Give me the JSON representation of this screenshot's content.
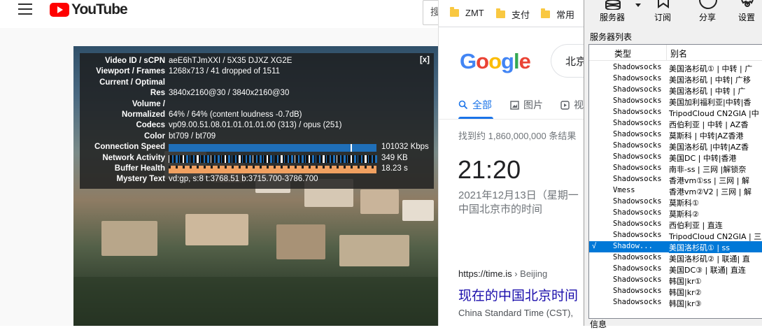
{
  "youtube": {
    "logo_text": "YouTube",
    "search_partial": "搜",
    "stats": {
      "close": "[x]",
      "rows": [
        {
          "key": "Video ID / sCPN",
          "value": "aeE6hTJmXXI / 5X35 DJXZ XG2E"
        },
        {
          "key": "Viewport / Frames",
          "value": "1268x713 / 41 dropped of 1511"
        },
        {
          "key": "Current / Optimal",
          "value": ""
        },
        {
          "key": "Res",
          "value": "3840x2160@30 / 3840x2160@30"
        },
        {
          "key": "Volume /",
          "value": ""
        },
        {
          "key": "Normalized",
          "value": "64% / 64% (content loudness -0.7dB)"
        },
        {
          "key": "Codecs",
          "value": "vp09.00.51.08.01.01.01.01.00 (313) / opus (251)"
        },
        {
          "key": "Color",
          "value": "bt709 / bt709"
        },
        {
          "key": "Connection Speed",
          "value": "101032 Kbps"
        },
        {
          "key": "Network Activity",
          "value": "349 KB"
        },
        {
          "key": "Buffer Health",
          "value": "18.23 s"
        },
        {
          "key": "Mystery Text",
          "value": "vd:gp, s:8 t:3768.51 b:3715.700-3786.700"
        }
      ],
      "colors": {
        "connection": "#1f6fb8",
        "network": "#1f6fb8",
        "buffer": "#f0a060"
      }
    }
  },
  "browser": {
    "bookmarks": [
      "ZMT",
      "支付",
      "常用"
    ],
    "google_logo": [
      "G",
      "o",
      "o",
      "g",
      "l",
      "e"
    ],
    "search_partial": "北京",
    "tabs": {
      "all": "全部",
      "images": "图片",
      "video": "视"
    },
    "result_count": "找到约 1,860,000,000 条结果",
    "time": "21:20",
    "date": "2021年12月13日（星期一",
    "location": "中国北京市的时间",
    "result": {
      "url": "https://time.is",
      "crumb": "› Beijing",
      "title": "现在的中国北京时间",
      "snippet": "China Standard Time (CST),"
    }
  },
  "server_window": {
    "toolbar": {
      "servers": "服务器",
      "subscribe": "订阅",
      "share": "分享",
      "settings": "设置"
    },
    "title": "服务器列表",
    "columns": {
      "type": "类型",
      "alias": "别名"
    },
    "rows": [
      {
        "check": "",
        "type": "Shadowsocks",
        "alias": "美国洛杉矶① | 中转 | 广"
      },
      {
        "check": "",
        "type": "Shadowsocks",
        "alias": "美国洛杉矶 | 中转| 广移"
      },
      {
        "check": "",
        "type": "Shadowsocks",
        "alias": "美国洛杉矶 | 中转 | 广"
      },
      {
        "check": "",
        "type": "Shadowsocks",
        "alias": "美国加利福利亚|中转|香"
      },
      {
        "check": "",
        "type": "Shadowsocks",
        "alias": "TripodCloud CN2GIA |中"
      },
      {
        "check": "",
        "type": "Shadowsocks",
        "alias": "西伯利亚 | 中转 | AZ香"
      },
      {
        "check": "",
        "type": "Shadowsocks",
        "alias": "莫斯科 | 中转|AZ香港"
      },
      {
        "check": "",
        "type": "Shadowsocks",
        "alias": "美国洛杉矶 |中转|AZ香"
      },
      {
        "check": "",
        "type": "Shadowsocks",
        "alias": "美国DC | 中转|香港"
      },
      {
        "check": "",
        "type": "Shadowsocks",
        "alias": "南非-ss | 三网 |解锁奈"
      },
      {
        "check": "",
        "type": "Shadowsocks",
        "alias": "香港vm①ss | 三网 | 解"
      },
      {
        "check": "",
        "type": "Vmess",
        "alias": "香港vm②V2 | 三网 | 解"
      },
      {
        "check": "",
        "type": "Shadowsocks",
        "alias": "莫斯科①"
      },
      {
        "check": "",
        "type": "Shadowsocks",
        "alias": "莫斯科②"
      },
      {
        "check": "",
        "type": "Shadowsocks",
        "alias": "西伯利亚 | 直连"
      },
      {
        "check": "",
        "type": "Shadowsocks",
        "alias": "TripodCloud CN2GIA | 三"
      },
      {
        "check": "√",
        "type": "Shadow...",
        "alias": "美国洛杉矶① | ss"
      },
      {
        "check": "",
        "type": "Shadowsocks",
        "alias": "美国洛杉矶② | 联通| 直"
      },
      {
        "check": "",
        "type": "Shadowsocks",
        "alias": "美国DC③ | 联通| 直连"
      },
      {
        "check": "",
        "type": "Shadowsocks",
        "alias": "韩国|kr①"
      },
      {
        "check": "",
        "type": "Shadowsocks",
        "alias": "韩国|kr②"
      },
      {
        "check": "",
        "type": "Shadowsocks",
        "alias": "韩国|kr③"
      }
    ],
    "selected_index": 16,
    "info_label": "信息"
  }
}
